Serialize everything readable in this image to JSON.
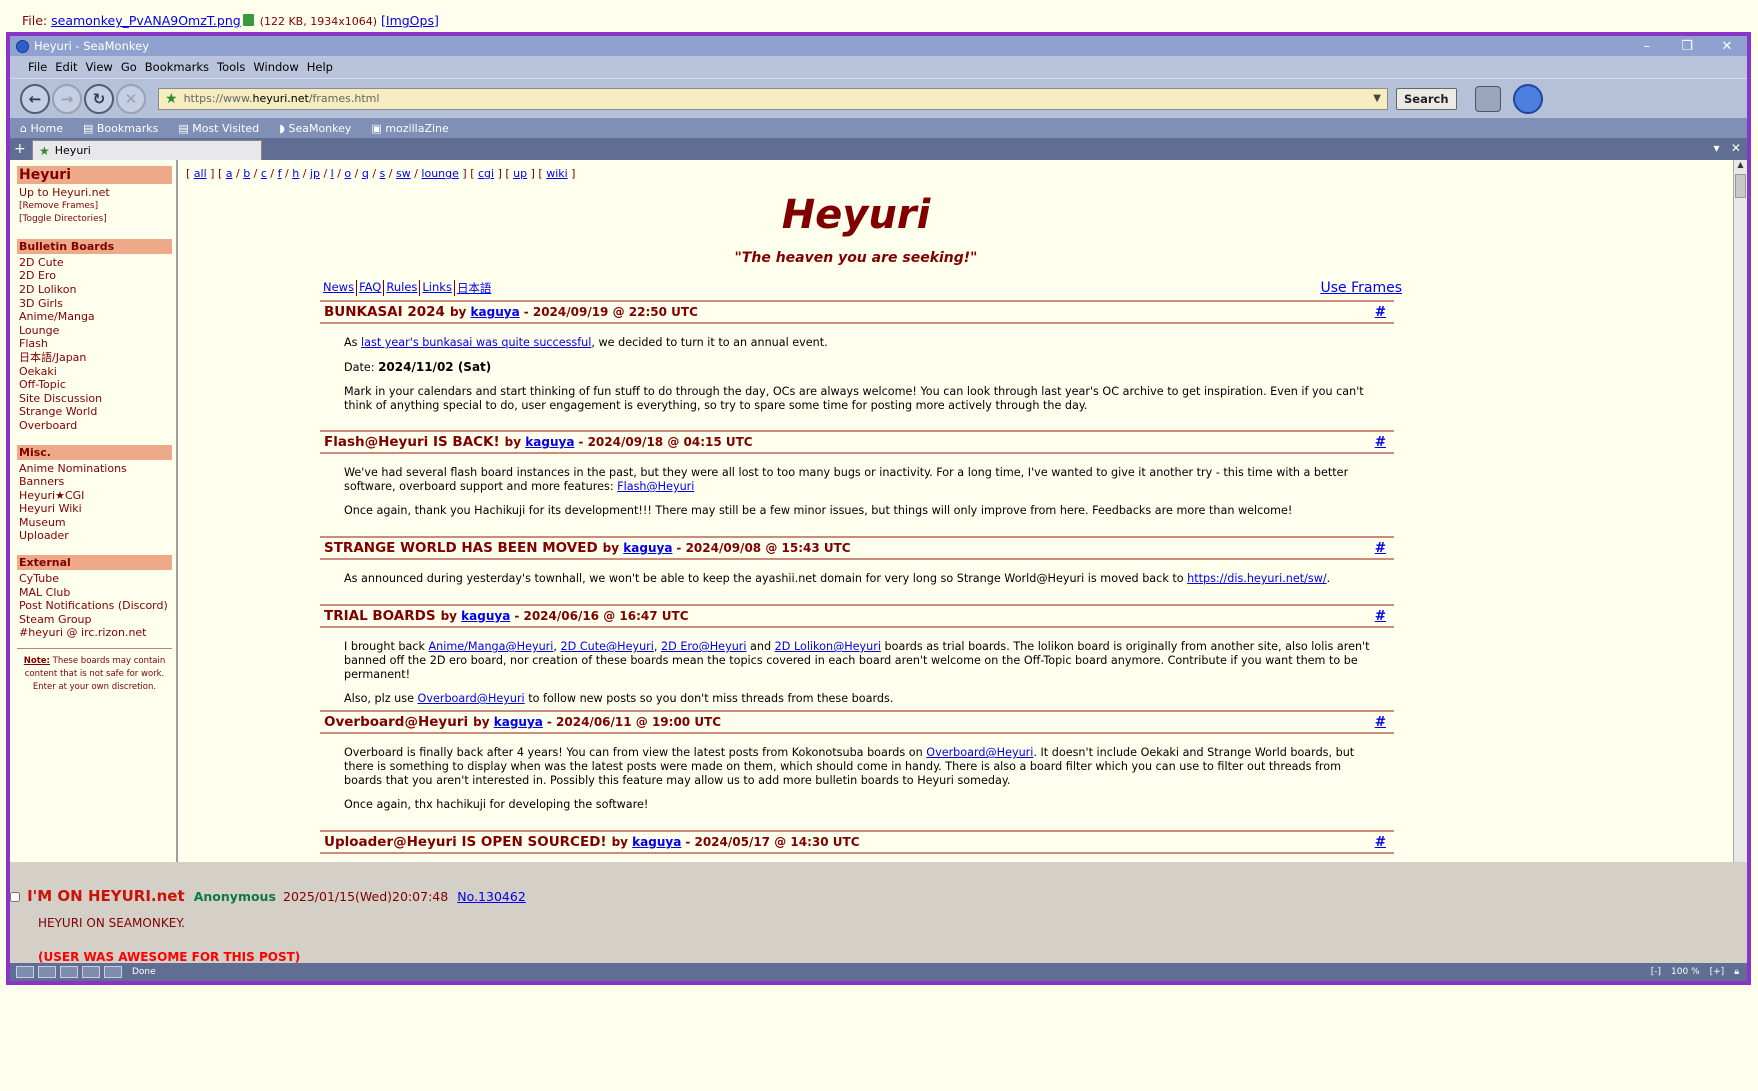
{
  "file": {
    "prefix": "File:",
    "name": "seamonkey_PvANA9OmzT.png",
    "meta": "(122 KB, 1934x1064)",
    "imgops": "[ImgOps]"
  },
  "browser": {
    "title": "Heyuri - SeaMonkey",
    "menus": [
      "File",
      "Edit",
      "View",
      "Go",
      "Bookmarks",
      "Tools",
      "Window",
      "Help"
    ],
    "url_prefix": "https://www.",
    "url_domain": "heyuri.net",
    "url_path": "/frames.html",
    "search_label": "Search",
    "bookmarks": [
      "Home",
      "Bookmarks",
      "Most Visited",
      "SeaMonkey",
      "mozillaZine"
    ],
    "tab_label": "Heyuri",
    "status_text": "Done",
    "zoom_out": "[-]",
    "zoom": "100 %",
    "zoom_in": "[+]"
  },
  "sidebar": {
    "heading": "Heyuri",
    "top_links": [
      "Up to Heyuri.net"
    ],
    "small_links": [
      "[Remove Frames]",
      "[Toggle Directories]"
    ],
    "sections": [
      {
        "title": "Bulletin Boards",
        "items": [
          "2D Cute",
          "2D Ero",
          "2D Lolikon",
          "3D Girls",
          "Anime/Manga",
          "Lounge",
          "Flash",
          "日本語/Japan",
          "Oekaki",
          "Off-Topic",
          "Site Discussion",
          "Strange World",
          "Overboard"
        ]
      },
      {
        "title": "Misc.",
        "items": [
          "Anime Nominations",
          "Banners",
          "Heyuri★CGI",
          "Heyuri Wiki",
          "Museum",
          "Uploader"
        ]
      },
      {
        "title": "External",
        "items": [
          "CyTube",
          "MAL Club",
          "Post Notifications (Discord)",
          "Steam Group",
          "#heyuri @ irc.rizon.net"
        ]
      }
    ],
    "note_label": "Note:",
    "note_text": " These boards may contain content that is not safe for work. Enter at your own discretion."
  },
  "main": {
    "board_links": [
      "all",
      "a",
      "b",
      "c",
      "f",
      "h",
      "jp",
      "l",
      "o",
      "q",
      "s",
      "sw",
      "lounge",
      "cgi",
      "up",
      "wiki"
    ],
    "logo": "Heyuri",
    "slogan": "\"The heaven you are seeking!\"",
    "nav": [
      "News",
      "FAQ",
      "Rules",
      "Links",
      "日本語"
    ],
    "use_frames": "Use Frames",
    "by": "by",
    "hash": "#",
    "posts": [
      {
        "title": "BUNKASAI 2024",
        "author": "kaguya",
        "date": "- 2024/09/19 @ 22:50 UTC",
        "p1_pre": "As ",
        "p1_link": "last year's bunkasai was quite successful",
        "p1_post": ", we decided to turn it to an annual event.",
        "p2_label": "Date: ",
        "p2_value": "2024/11/02 (Sat)",
        "p3": "Mark in your calendars and start thinking of fun stuff to do through the day, OCs are always welcome! You can look through last year's OC archive to get inspiration. Even if you can't think of anything special to do, user engagement is everything, so try to spare some time for posting more actively through the day."
      },
      {
        "title": "Flash@Heyuri IS BACK!",
        "author": "kaguya",
        "date": "- 2024/09/18 @ 04:15 UTC",
        "p1_pre": "We've had several flash board instances in the past, but they were all lost to too many bugs or inactivity. For a long time, I've wanted to give it another try - this time with a better software, overboard support and more features: ",
        "p1_link": "Flash@Heyuri",
        "p2": "Once again, thank you Hachikuji for its development!!! There may still be a few minor issues, but things will only improve from here. Feedbacks are more than welcome!"
      },
      {
        "title": "STRANGE WORLD HAS BEEN MOVED",
        "author": "kaguya",
        "date": "- 2024/09/08 @ 15:43 UTC",
        "p1_pre": "As announced during yesterday's townhall, we won't be able to keep the ayashii.net domain for very long so Strange World@Heyuri is moved back to ",
        "p1_link": "https://dis.heyuri.net/sw/",
        "p1_post": "."
      },
      {
        "title": "TRIAL BOARDS",
        "author": "kaguya",
        "date": "- 2024/06/16 @ 16:47 UTC",
        "p1_a": "I brought back ",
        "l1": "Anime/Manga@Heyuri",
        "sep1": ", ",
        "l2": "2D Cute@Heyuri",
        "sep2": ", ",
        "l3": "2D Ero@Heyuri",
        "sep3": " and ",
        "l4": "2D Lolikon@Heyuri",
        "p1_b": " boards as trial boards. The lolikon board is originally from another site, also lolis aren't banned off the 2D ero board, nor creation of these boards mean the topics covered in each board aren't welcome on the Off-Topic board anymore. Contribute if you want them to be permanent!",
        "p2_pre": "Also, plz use ",
        "p2_link": "Overboard@Heyuri",
        "p2_post": " to follow new posts so you don't miss threads from these boards."
      },
      {
        "title": "Overboard@Heyuri",
        "author": "kaguya",
        "date": "- 2024/06/11 @ 19:00 UTC",
        "p1_pre": "Overboard is finally back after 4 years! You can from view the latest posts from Kokonotsuba boards on ",
        "p1_link": "Overboard@Heyuri",
        "p1_post": ". It doesn't include Oekaki and Strange World boards, but there is something to display when was the latest posts were made on them, which should come in handy. There is also a board filter which you can use to filter out threads from boards that you aren't interested in. Possibly this feature may allow us to add more bulletin boards to Heyuri someday.",
        "p2": "Once again, thx hachikuji for developing the software!"
      },
      {
        "title": "Uploader@Heyuri IS OPEN SOURCED!",
        "author": "kaguya",
        "date": "- 2024/05/17 @ 14:30 UTC"
      }
    ]
  },
  "reply": {
    "subject": "I'M ON HEYURI.net",
    "name": "Anonymous",
    "date": "2025/01/15(Wed)20:07:48",
    "number": "No.130462",
    "text": "HEYURI ON SEAMONKEY.",
    "ban": "(USER WAS AWESOME FOR THIS POST)"
  }
}
